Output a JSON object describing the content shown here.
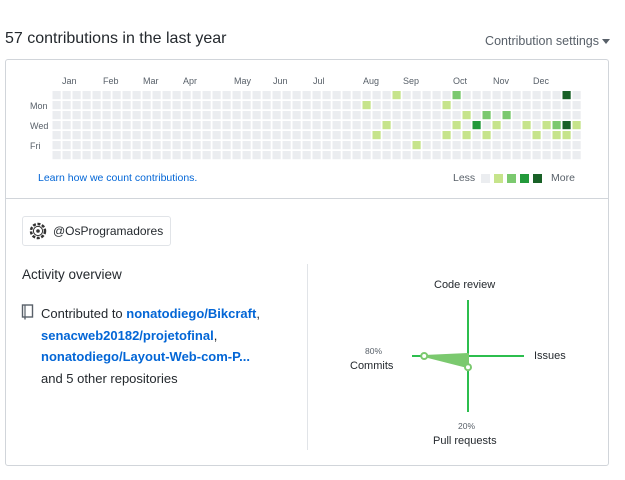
{
  "header": {
    "title": "57 contributions in the last year",
    "settings_label": "Contribution settings"
  },
  "calendar": {
    "months": [
      "Jan",
      "Feb",
      "Mar",
      "Apr",
      "May",
      "Jun",
      "Jul",
      "Aug",
      "Sep",
      "Oct",
      "Nov",
      "Dec"
    ],
    "days": [
      "Mon",
      "Wed",
      "Fri"
    ],
    "learn_link": "Learn how we count contributions.",
    "legend_less": "Less",
    "legend_more": "More",
    "colors": [
      "#ebedf0",
      "#c6e48b",
      "#7bc96f",
      "#239a3b",
      "#196127"
    ],
    "cells": [
      {
        "week": 37,
        "day": 1,
        "level": 1
      },
      {
        "week": 38,
        "day": 4,
        "level": 1
      },
      {
        "week": 39,
        "day": 3,
        "level": 1
      },
      {
        "week": 40,
        "day": 0,
        "level": 1
      },
      {
        "week": 42,
        "day": 5,
        "level": 1
      },
      {
        "week": 45,
        "day": 1,
        "level": 1
      },
      {
        "week": 45,
        "day": 4,
        "level": 1
      },
      {
        "week": 46,
        "day": 0,
        "level": 2
      },
      {
        "week": 47,
        "day": 2,
        "level": 1
      },
      {
        "week": 47,
        "day": 4,
        "level": 1
      },
      {
        "week": 48,
        "day": 3,
        "level": 3
      },
      {
        "week": 49,
        "day": 2,
        "level": 2
      },
      {
        "week": 49,
        "day": 4,
        "level": 1
      },
      {
        "week": 50,
        "day": 3,
        "level": 1
      },
      {
        "week": 51,
        "day": 2,
        "level": 2
      },
      {
        "week": 53,
        "day": 3,
        "level": 1
      },
      {
        "week": 54,
        "day": 4,
        "level": 1
      },
      {
        "week": 55,
        "day": 3,
        "level": 1
      },
      {
        "week": 56,
        "day": 3,
        "level": 2
      },
      {
        "week": 56,
        "day": 4,
        "level": 1
      },
      {
        "week": 57,
        "day": 0,
        "level": 4
      },
      {
        "week": 57,
        "day": 3,
        "level": 4
      },
      {
        "week": 57,
        "day": 4,
        "level": 1
      },
      {
        "week": 58,
        "day": 3,
        "level": 1
      },
      {
        "week": 46,
        "day": 3,
        "level": 1
      }
    ]
  },
  "org": {
    "label": "@OsProgramadores"
  },
  "activity": {
    "title": "Activity overview",
    "prefix": "Contributed to",
    "repos": [
      "nonatodiego/Bikcraft",
      "senacweb20182/projetofinal",
      "nonatodiego/Layout-Web-com-P..."
    ],
    "suffix": "and 5 other repositories"
  },
  "radar": {
    "code_review_label": "Code review",
    "issues_label": "Issues",
    "commits_label": "Commits",
    "commits_pct": "80%",
    "pull_requests_label": "Pull requests",
    "pull_requests_pct": "20%",
    "commits": 80,
    "pull_requests": 20,
    "code_review": 0,
    "issues": 0,
    "accent": "#2cbe4e",
    "fill": "#7bc96f"
  }
}
